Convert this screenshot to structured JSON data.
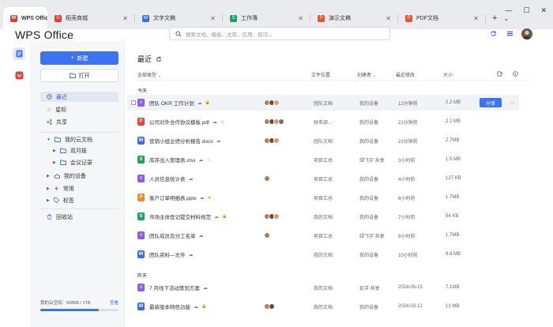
{
  "tabs": [
    {
      "label": "WPS Office",
      "icon": "wps-logo-icon",
      "color": "#e03c31"
    },
    {
      "label": "稻壳商城",
      "icon": "docer-icon",
      "color": "#e03c31"
    },
    {
      "label": "文字文稿",
      "icon": "word-doc-icon",
      "color": "#3a6ee8"
    },
    {
      "label": "工作簿",
      "icon": "spreadsheet-icon",
      "color": "#1aa260"
    },
    {
      "label": "演示文稿",
      "icon": "presentation-icon",
      "color": "#e8542e"
    },
    {
      "label": "PDF文档",
      "icon": "pdf-icon",
      "color": "#e8542e"
    }
  ],
  "window_controls": {
    "new_tab": "+",
    "menu": "⌄",
    "minimize": "—",
    "maximize": "☐",
    "close": "✕"
  },
  "app_title": "WPS Office",
  "search": {
    "placeholder": "搜索文档、模板、文库、应用、技巧..."
  },
  "sidebar": {
    "new_label": "新建",
    "open_label": "打开",
    "nav": [
      {
        "label": "最近",
        "icon": "clock-icon"
      },
      {
        "label": "星标",
        "icon": "star-icon"
      },
      {
        "label": "共享",
        "icon": "share-icon"
      }
    ],
    "cloud": {
      "label": "我的云文档",
      "children": [
        {
          "label": "双月报"
        },
        {
          "label": "会议记录"
        }
      ]
    },
    "devices": "我的设备",
    "common": "常用",
    "tags": "标签",
    "trash": "回收站",
    "storage": {
      "label": "我的云空间：5080B / 1TB",
      "action": "查看",
      "fraction": 0.75
    }
  },
  "main": {
    "title": "最近",
    "columns": {
      "all_types": "全部类型",
      "location": "文件位置",
      "creator": "创建者",
      "modified": "最近修改",
      "size": "大小"
    },
    "groups": [
      {
        "label": "今天",
        "rows": [
          {
            "type": "doc-purple",
            "name": "团队 OKR 工作计划",
            "indicators": [
              "cloud-icon",
              "lock-icon"
            ],
            "collab": 3,
            "location": "团队文档",
            "creator": "我的设备",
            "modified": "12分钟前",
            "size": "2.2 MB",
            "highlight": true
          },
          {
            "type": "pdf",
            "name": "公司对外合作协议模板.pdf",
            "indicators": [
              "cloud-icon",
              "star-outline-icon"
            ],
            "collab": 4,
            "location": "财务部...",
            "creator": "我的设备",
            "modified": "21分钟前",
            "size": "2.2 MB"
          },
          {
            "type": "word",
            "name": "营销小组业绩分析报告.docx",
            "indicators": [
              "cloud-icon"
            ],
            "collab": 3,
            "location": "团队文档",
            "creator": "我的设备",
            "modified": "21分钟前",
            "size": "2.7MB"
          },
          {
            "type": "sheet",
            "name": "库存出入管理表.xlsx",
            "indicators": [
              "cloud-icon",
              "star-outline-icon"
            ],
            "collab": 0,
            "location": "项目汇总",
            "creator": "绿飞宇 共享",
            "modified": "3小时前",
            "size": "1.5 MB"
          },
          {
            "type": "doc-purple",
            "name": "人员信息统计表",
            "indicators": [
              "cloud-icon"
            ],
            "collab": 1,
            "location": "项目汇总",
            "creator": "我的设备",
            "modified": "4小时前",
            "size": "127 KB"
          },
          {
            "type": "ppt",
            "name": "客户订单明细表.pptx",
            "indicators": [
              "cloud-icon",
              "star-filled-icon"
            ],
            "collab": 0,
            "location": "项目汇总",
            "creator": "我的设备",
            "modified": "6小时前",
            "size": "1.7MB"
          },
          {
            "type": "sheet",
            "name": "市场主体登记提交材料规范",
            "indicators": [
              "cloud-icon",
              "lock-icon"
            ],
            "collab": 3,
            "location": "我的文档",
            "creator": "我的设备",
            "modified": "7小时前",
            "size": "54 KB"
          },
          {
            "type": "doc-purple",
            "name": "团队成员及分工名单",
            "indicators": [
              "cloud-icon"
            ],
            "collab": 1,
            "location": "项目汇总",
            "creator": "绿飞宇 共享",
            "modified": "8小时前",
            "size": "1.7MB"
          },
          {
            "type": "word",
            "name": "团队资料—文件",
            "indicators": [
              "cloud-icon"
            ],
            "collab": 0,
            "location": "我的文档",
            "creator": "我的设备",
            "modified": "10小时前",
            "size": "9.8 MB"
          }
        ]
      },
      {
        "label": "昨天",
        "rows": [
          {
            "type": "doc-purple",
            "name": "7 月线下活动策划方案",
            "indicators": [
              "cloud-icon"
            ],
            "collab": 0,
            "location": "我的文档",
            "creator": "彭洋 共享",
            "modified": "2024-05-15",
            "size": "7.1MB"
          },
          {
            "type": "word",
            "name": "最新版本特色功能",
            "indicators": [
              "cloud-icon",
              "lock-icon"
            ],
            "collab": 2,
            "location": "我的文档",
            "creator": "我的设备",
            "modified": "2024-03-12",
            "size": "13 MB"
          }
        ]
      }
    ],
    "share_label": "分享",
    "more_label": "···"
  },
  "colors": {
    "accent": "#3b73f0",
    "word": "#3a6ee8",
    "sheet": "#1aa260",
    "ppt": "#f08a24",
    "pdf": "#e8433a",
    "doc-purple": "#8a5cf0"
  }
}
